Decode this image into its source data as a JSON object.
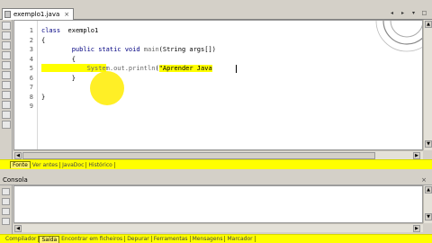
{
  "editor_tab": {
    "label": "exemplo1.java",
    "close": "×"
  },
  "tab_controls": [
    "◂",
    "▸",
    "▾",
    "□"
  ],
  "code": {
    "line_numbers": [
      "1",
      "2",
      "3",
      "4",
      "5",
      "6",
      "7",
      "8",
      "9"
    ],
    "lines": [
      [
        {
          "t": "class  ",
          "c": "kw"
        },
        {
          "t": "exemplo1",
          "c": "pl"
        }
      ],
      [
        {
          "t": "{",
          "c": "pl"
        }
      ],
      [
        {
          "t": "        public static void ",
          "c": "kw"
        },
        {
          "t": "main",
          "c": "fn"
        },
        {
          "t": "(String args[])",
          "c": "pl"
        }
      ],
      [
        {
          "t": "        {",
          "c": "pl"
        }
      ],
      [
        {
          "t": "            System.out.println",
          "c": "fn"
        },
        {
          "t": "(",
          "c": "pl"
        },
        {
          "t": "\"Aprender Java",
          "c": "str"
        }
      ],
      [
        {
          "t": "        }",
          "c": "pl"
        }
      ],
      [
        {
          "t": "",
          "c": "pl"
        }
      ],
      [
        {
          "t": "}",
          "c": "pl"
        }
      ],
      [
        {
          "t": "",
          "c": "pl"
        }
      ]
    ]
  },
  "editor_subtabs": [
    "Fonte",
    "Ver antes",
    "JavaDoc",
    "Histórico"
  ],
  "console": {
    "title": "Consola",
    "close": "×"
  },
  "bottom_tabs": [
    "Compilador",
    "Saída",
    "Encontrar em ficheiros",
    "Depurar",
    "Ferramentas",
    "Mensagens",
    "Marcador"
  ],
  "scroll_arrows": {
    "up": "▲",
    "down": "▼",
    "left": "◀",
    "right": "▶"
  },
  "colors": {
    "highlight": "#ffff00",
    "keyword": "#000080",
    "panel": "#d4d0c8"
  }
}
